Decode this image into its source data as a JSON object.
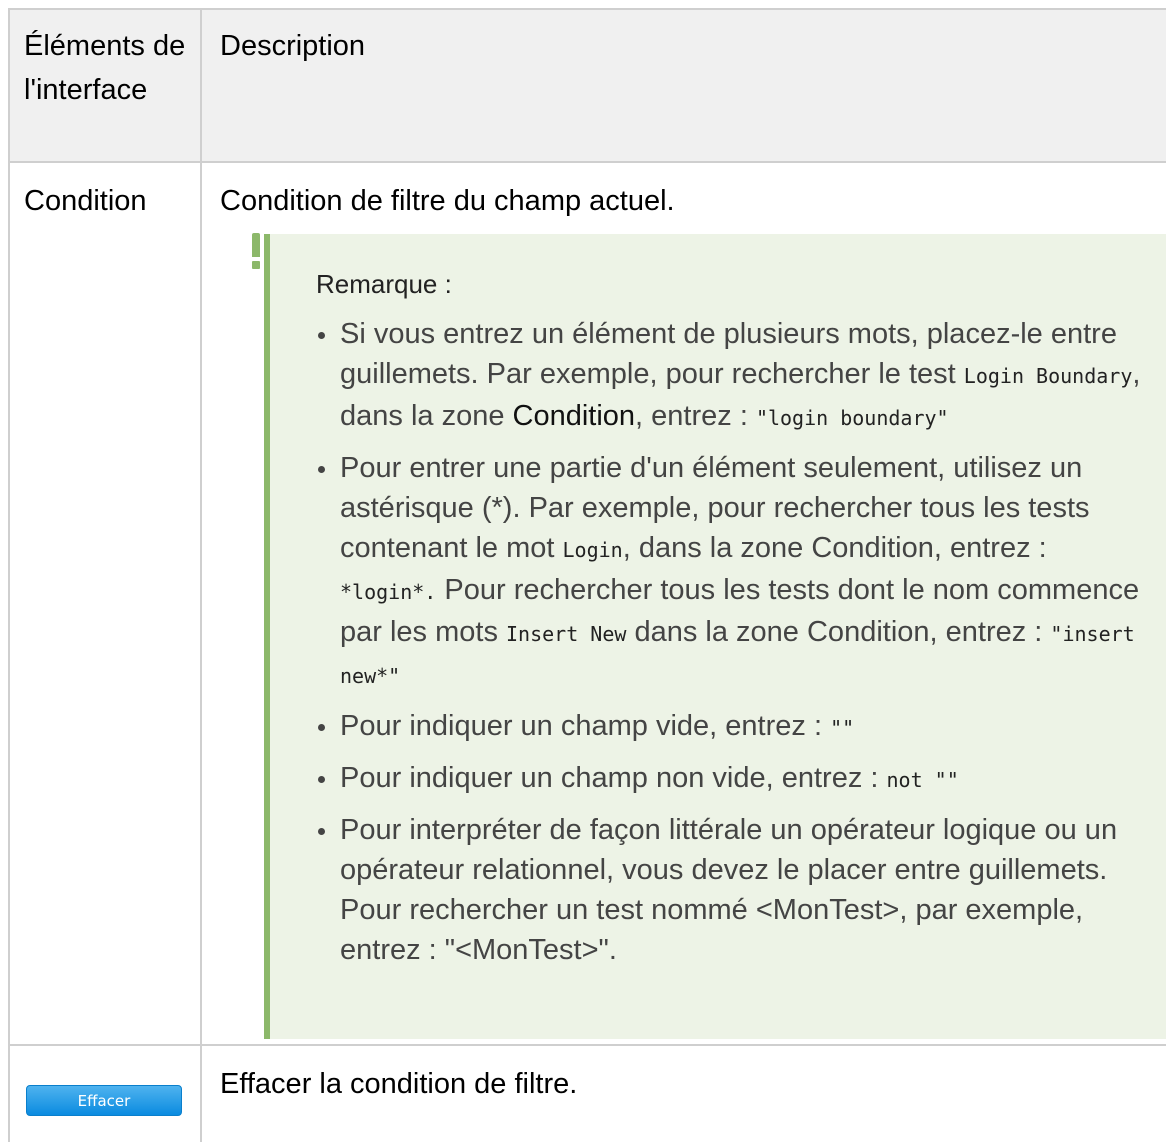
{
  "table": {
    "header": {
      "col1": "Éléments de l'interface",
      "col2": "Description"
    },
    "rows": [
      {
        "element": "Condition",
        "description": "Condition de filtre du champ actuel."
      },
      {
        "button_label": "Effacer",
        "description": "Effacer la condition de filtre."
      }
    ]
  },
  "note": {
    "title": "Remarque :",
    "items": [
      {
        "t1": "Si vous entrez un élément de plusieurs mots, placez-le entre guillemets. Par exemple, pour rechercher le test ",
        "c1": "Login Boundary",
        "t2": ", dans la zone ",
        "b1": "Condition",
        "t3": ", entrez : ",
        "c2": "\"login boundary\""
      },
      {
        "t1": "Pour entrer une partie d'un élément seulement, utilisez un astérisque (*). Par exemple, pour rechercher tous les tests contenant le mot ",
        "c1": "Login",
        "t2": ", dans la zone Condition, entrez : ",
        "c2": "*login*.",
        "t3": " Pour rechercher tous les tests dont le nom commence par les mots ",
        "c3": "Insert New",
        "t4": " dans la zone Condition, entrez : ",
        "c4": "\"insert new*\""
      },
      {
        "t1": "Pour indiquer un champ vide, entrez : ",
        "c1": "\"\""
      },
      {
        "t1": "Pour indiquer un champ non vide, entrez : ",
        "c1": "not \"\""
      },
      {
        "t1": "Pour interpréter de façon littérale un opérateur logique ou un opérateur relationnel, vous devez le placer entre guillemets. Pour rechercher un test nommé <MonTest>, par exemple, entrez : \"<MonTest>\"."
      }
    ]
  },
  "colors": {
    "note_bg": "#edf3e6",
    "note_accent": "#8cb86a",
    "header_bg": "#f0f0f0",
    "button_blue": "#0a8be0"
  },
  "icons": {
    "note": "exclamation-icon"
  }
}
